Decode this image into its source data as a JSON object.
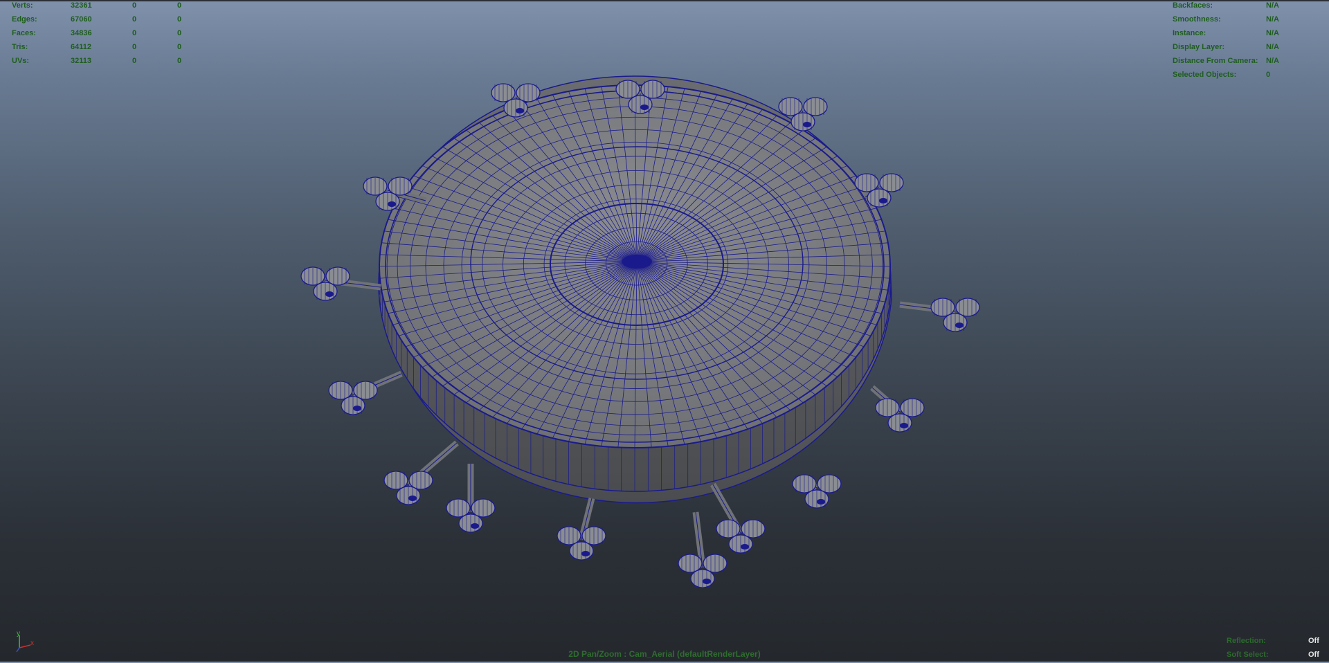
{
  "hud_left": {
    "rows": [
      {
        "label": "Verts:",
        "v1": "32361",
        "v2": "0",
        "v3": "0"
      },
      {
        "label": "Edges:",
        "v1": "67060",
        "v2": "0",
        "v3": "0"
      },
      {
        "label": "Faces:",
        "v1": "34836",
        "v2": "0",
        "v3": "0"
      },
      {
        "label": "Tris:",
        "v1": "64112",
        "v2": "0",
        "v3": "0"
      },
      {
        "label": "UVs:",
        "v1": "32113",
        "v2": "0",
        "v3": "0"
      }
    ]
  },
  "hud_right": {
    "rows": [
      {
        "label": "Backfaces:",
        "value": "N/A"
      },
      {
        "label": "Smoothness:",
        "value": "N/A"
      },
      {
        "label": "Instance:",
        "value": "N/A"
      },
      {
        "label": "Display Layer:",
        "value": "N/A"
      },
      {
        "label": "Distance From Camera:",
        "value": "N/A"
      },
      {
        "label": "Selected Objects:",
        "value": "0"
      }
    ]
  },
  "hud_bottom_right": {
    "rows": [
      {
        "label": "Reflection:",
        "value": "Off"
      },
      {
        "label": "Soft Select:",
        "value": "Off"
      }
    ]
  },
  "camera_label": "2D Pan/Zoom : Cam_Aerial (defaultRenderLayer)",
  "axis": {
    "y": "y",
    "x": "x"
  },
  "colors": {
    "wire": "#1a1a8c",
    "mesh_fill": "#7a7c80",
    "hud_text": "#1f5d1f"
  }
}
